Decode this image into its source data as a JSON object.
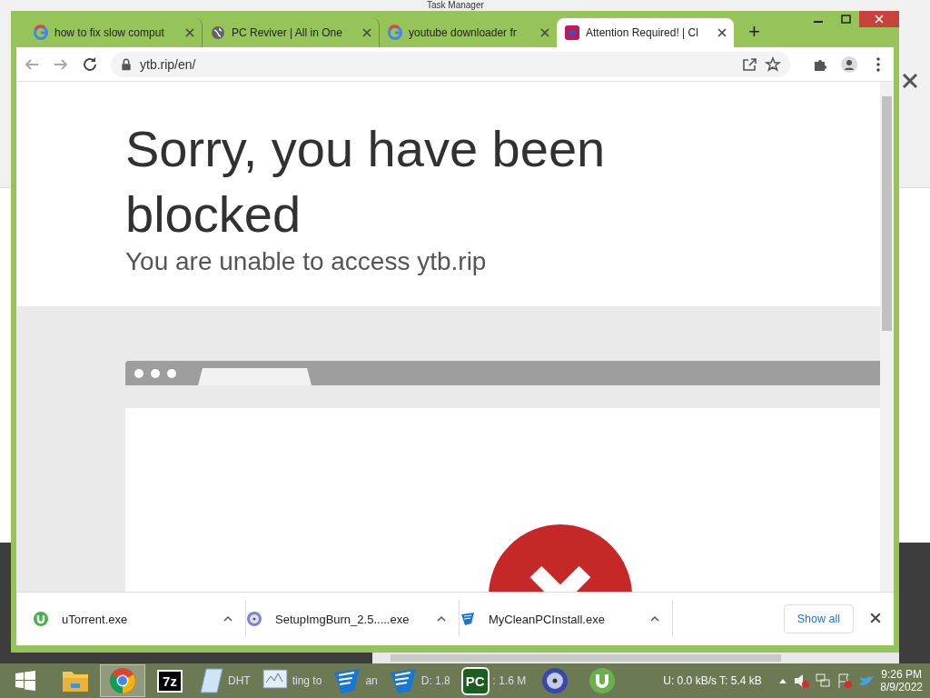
{
  "background_window": {
    "title": "Task Manager"
  },
  "browser": {
    "tabs": [
      {
        "title": "how to fix slow comput",
        "kind": "google",
        "selected": false
      },
      {
        "title": "PC Reviver | All in One",
        "kind": "globe",
        "selected": false
      },
      {
        "title": "youtube downloader fr",
        "kind": "google",
        "selected": false
      },
      {
        "title": "Attention Required! | Cl",
        "kind": "shield",
        "selected": true
      }
    ],
    "new_tab": "+",
    "address": "ytb.rip/en/"
  },
  "page": {
    "heading": "Sorry, you have been blocked",
    "subheading": "You are unable to access ytb.rip"
  },
  "downloads": {
    "items": [
      {
        "filename": "uTorrent.exe",
        "kind": "utorrent"
      },
      {
        "filename": "SetupImgBurn_2.5.....exe",
        "kind": "disc"
      },
      {
        "filename": "MyCleanPCInstall.exe",
        "kind": "shield"
      }
    ],
    "show_all": "Show all"
  },
  "taskbar": {
    "apps": [
      {
        "kind": "folder",
        "active": false
      },
      {
        "kind": "chrome",
        "active": true
      },
      {
        "kind": "sevenzip",
        "label": "7z",
        "active": false
      },
      {
        "kind": "notepad",
        "text": "DHT",
        "active": false
      },
      {
        "kind": "monitor",
        "text": "ting to",
        "active": false
      },
      {
        "kind": "shield",
        "text": "an",
        "active": false
      },
      {
        "kind": "shield",
        "text": "D: 1.8",
        "active": false
      },
      {
        "kind": "pcreviver",
        "label": "PC",
        "text": ": 1.6 M",
        "active": false
      },
      {
        "kind": "disc",
        "active": false
      },
      {
        "kind": "utorrent",
        "active": false
      }
    ],
    "torrent_status": "U: 0.0 kB/s T: 5.4 kB",
    "time": "9:26 PM",
    "date": "8/9/2022"
  }
}
